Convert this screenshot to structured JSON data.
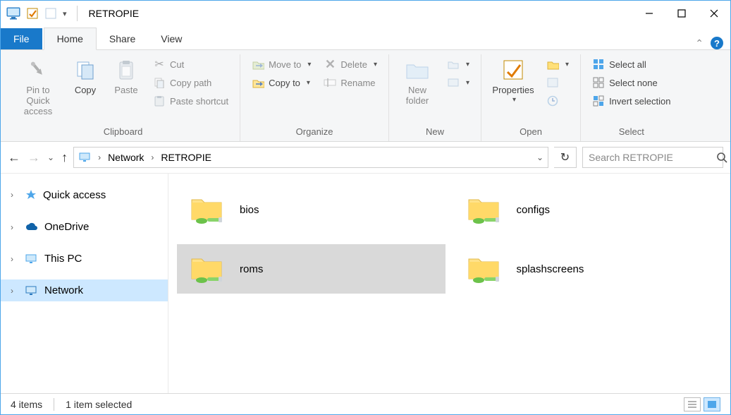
{
  "window": {
    "title": "RETROPIE"
  },
  "tabs": {
    "file": "File",
    "home": "Home",
    "share": "Share",
    "view": "View"
  },
  "ribbon": {
    "clipboard": {
      "label": "Clipboard",
      "pin": "Pin to Quick access",
      "copy": "Copy",
      "paste": "Paste",
      "cut": "Cut",
      "copy_path": "Copy path",
      "paste_shortcut": "Paste shortcut"
    },
    "organize": {
      "label": "Organize",
      "move_to": "Move to",
      "copy_to": "Copy to",
      "delete": "Delete",
      "rename": "Rename"
    },
    "new": {
      "label": "New",
      "new_folder": "New folder"
    },
    "open": {
      "label": "Open",
      "properties": "Properties"
    },
    "select": {
      "label": "Select",
      "select_all": "Select all",
      "select_none": "Select none",
      "invert": "Invert selection"
    }
  },
  "breadcrumb": {
    "root": "Network",
    "leaf": "RETROPIE"
  },
  "search": {
    "placeholder": "Search RETROPIE"
  },
  "sidebar": {
    "quick_access": "Quick access",
    "onedrive": "OneDrive",
    "this_pc": "This PC",
    "network": "Network"
  },
  "items": [
    {
      "name": "bios",
      "selected": false
    },
    {
      "name": "configs",
      "selected": false
    },
    {
      "name": "roms",
      "selected": true
    },
    {
      "name": "splashscreens",
      "selected": false
    }
  ],
  "status": {
    "count": "4 items",
    "selected": "1 item selected"
  }
}
